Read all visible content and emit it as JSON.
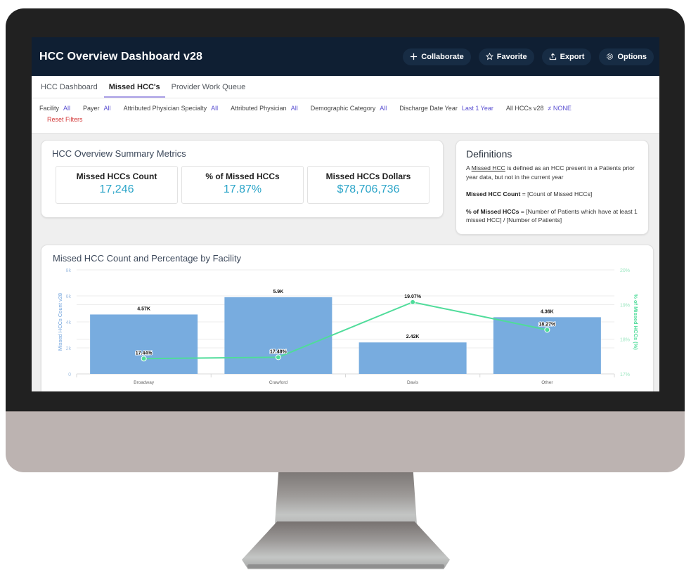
{
  "header": {
    "title": "HCC Overview Dashboard v28",
    "actions": [
      {
        "label": "Collaborate",
        "icon": "plus-icon"
      },
      {
        "label": "Favorite",
        "icon": "star-icon"
      },
      {
        "label": "Export",
        "icon": "upload-icon"
      },
      {
        "label": "Options",
        "icon": "gear-icon"
      }
    ]
  },
  "tabs": [
    {
      "label": "HCC Dashboard",
      "active": false
    },
    {
      "label": "Missed HCC's",
      "active": true
    },
    {
      "label": "Provider Work Queue",
      "active": false
    }
  ],
  "filters": {
    "items": [
      {
        "label": "Facility",
        "value": "All"
      },
      {
        "label": "Payer",
        "value": "All"
      },
      {
        "label": "Attributed Physician Specialty",
        "value": "All"
      },
      {
        "label": "Attributed Physician",
        "value": "All"
      },
      {
        "label": "Demographic Category",
        "value": "All"
      },
      {
        "label": "Discharge Date Year",
        "value": "Last 1 Year"
      },
      {
        "label": "All HCCs v28",
        "value": "≠ NONE"
      }
    ],
    "reset_label": "Reset Filters"
  },
  "summary": {
    "title": "HCC Overview Summary Metrics",
    "metrics": [
      {
        "label": "Missed HCCs Count",
        "value": "17,246"
      },
      {
        "label": "% of Missed HCCs",
        "value": "17.87%"
      },
      {
        "label": "Missed HCCs Dollars",
        "value": "$78,706,736"
      }
    ]
  },
  "definitions": {
    "title": "Definitions",
    "intro_prefix": "A ",
    "intro_term": "Missed HCC",
    "intro_suffix": " is defined as an HCC present in a Patients prior year data, but not in the current year",
    "count_term": "Missed HCC Count",
    "count_def": " = [Count of Missed HCCs]",
    "pct_term": "% of Missed HCCs",
    "pct_def": " = [Number of Patients which have at least 1 missed HCC] / [Number of Patients]"
  },
  "colors": {
    "header_bg": "#0f1f33",
    "bar": "#78acdf",
    "line": "#4fdc9a",
    "metric_value": "#2aa4c8",
    "filter_value": "#5a4fd1",
    "reset": "#d33a3a"
  },
  "chart_data": {
    "type": "bar",
    "title": "Missed HCC Count and Percentage by Facility",
    "categories": [
      "Broadway",
      "Crawford",
      "Davis",
      "Other"
    ],
    "series": [
      {
        "name": "Missed HCCs Count v28",
        "type": "bar",
        "axis": "left",
        "values": [
          4570,
          5900,
          2420,
          4360
        ],
        "labels": [
          "4.57K",
          "5.9K",
          "2.42K",
          "4.36K"
        ]
      },
      {
        "name": "% of Missed HCCs (%)",
        "type": "line",
        "axis": "right",
        "values": [
          17.44,
          17.48,
          19.07,
          18.27
        ],
        "labels": [
          "17.44%",
          "17.48%",
          "19.07%",
          "18.27%"
        ]
      }
    ],
    "ylabel": "Missed HCCs Count v28",
    "ylim": [
      0,
      8000
    ],
    "yticks": [
      "0",
      "2k",
      "4k",
      "6k",
      "8k"
    ],
    "y2label": "% of Missed HCCs (%)",
    "y2lim": [
      17,
      20
    ],
    "y2ticks": [
      "17%",
      "18%",
      "19%",
      "20%"
    ],
    "grid": true,
    "legend": "none"
  }
}
